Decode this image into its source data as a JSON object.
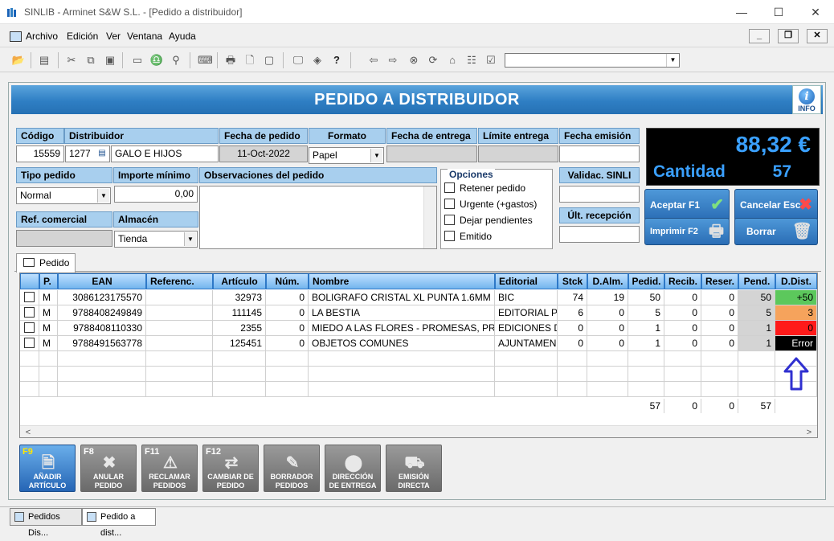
{
  "window": {
    "title": "SINLIB - Arminet S&W S.L. - [Pedido a distribuidor]",
    "minimize": "—",
    "maximize": "☐",
    "close": "✕"
  },
  "menu": {
    "items": [
      "Archivo",
      "Edición",
      "Ver",
      "Ventana",
      "Ayuda"
    ],
    "mdi_min": "_",
    "mdi_restore": "❐",
    "mdi_close": "✕"
  },
  "banner": {
    "title": "PEDIDO A DISTRIBUIDOR",
    "info_label": "INFO"
  },
  "header": {
    "codigo_label": "Código",
    "codigo": "15559",
    "distribuidor_label": "Distribuidor",
    "distribuidor_code": "1277",
    "distribuidor_name": "GALO E HIJOS",
    "fecha_pedido_label": "Fecha de pedido",
    "fecha_pedido": "11-Oct-2022",
    "formato_label": "Formato",
    "formato": "Papel",
    "fecha_entrega_label": "Fecha de entrega",
    "fecha_entrega": "",
    "limite_entrega_label": "Límite entrega",
    "limite_entrega": "",
    "fecha_emision_label": "Fecha emisión",
    "fecha_emision": "",
    "tipo_pedido_label": "Tipo pedido",
    "tipo_pedido": "Normal",
    "importe_minimo_label": "Importe mínimo",
    "importe_minimo": "0,00",
    "observaciones_label": "Observaciones del pedido",
    "observaciones": "",
    "ref_comercial_label": "Ref. comercial",
    "ref_comercial": "",
    "almacen_label": "Almacén",
    "almacen": "Tienda",
    "validac_label": "Validac. SINLI",
    "validac": "",
    "ult_recepcion_label": "Últ. recepción",
    "ult_recepcion": ""
  },
  "opciones": {
    "title": "Opciones",
    "items": [
      "Retener pedido",
      "Urgente (+gastos)",
      "Dejar pendientes",
      "Emitido"
    ]
  },
  "total": {
    "amount": "88,32 €",
    "label": "Cantidad",
    "qty": "57"
  },
  "actions": {
    "aceptar": "Aceptar F1",
    "cancelar": "Cancelar Esc",
    "imprimir": "Imprimir F2",
    "borrar": "Borrar"
  },
  "tab": {
    "label": "Pedido"
  },
  "grid": {
    "headers": [
      "P.",
      "EAN",
      "Referenc.",
      "Artículo",
      "Núm.",
      "Nombre",
      "Editorial",
      "Stck",
      "D.Alm.",
      "Pedid.",
      "Recib.",
      "Reser.",
      "Pend.",
      "D.Dist."
    ],
    "rows": [
      {
        "p": "M",
        "ean": "3086123175570",
        "ref": "",
        "articulo": "32973",
        "num": "0",
        "nombre": "BOLIGRAFO CRISTAL XL PUNTA 1.6MM",
        "editorial": "BIC",
        "stck": "74",
        "dalm": "19",
        "pedid": "50",
        "recib": "0",
        "reser": "0",
        "pend": "50",
        "ddist": "+50",
        "ddist_bg": "#5cc85c",
        "ddist_fg": "#000000"
      },
      {
        "p": "M",
        "ean": "9788408249849",
        "ref": "",
        "articulo": "111145",
        "num": "0",
        "nombre": "LA BESTIA",
        "editorial": "EDITORIAL P",
        "stck": "6",
        "dalm": "0",
        "pedid": "5",
        "recib": "0",
        "reser": "0",
        "pend": "5",
        "ddist": "3",
        "ddist_bg": "#f6a35c",
        "ddist_fg": "#000000"
      },
      {
        "p": "M",
        "ean": "9788408110330",
        "ref": "",
        "articulo": "2355",
        "num": "0",
        "nombre": "MIEDO A LAS FLORES - PROMESAS, PR",
        "editorial": "EDICIONES D",
        "stck": "0",
        "dalm": "0",
        "pedid": "1",
        "recib": "0",
        "reser": "0",
        "pend": "1",
        "ddist": "0",
        "ddist_bg": "#ff1a1a",
        "ddist_fg": "#000000"
      },
      {
        "p": "M",
        "ean": "9788491563778",
        "ref": "",
        "articulo": "125451",
        "num": "0",
        "nombre": "OBJETOS COMUNES",
        "editorial": "AJUNTAMEN",
        "stck": "0",
        "dalm": "0",
        "pedid": "1",
        "recib": "0",
        "reser": "0",
        "pend": "1",
        "ddist": "Error",
        "ddist_bg": "#000000",
        "ddist_fg": "#ffffff"
      }
    ],
    "totals": {
      "pedid": "57",
      "recib": "0",
      "reser": "0",
      "pend": "57"
    }
  },
  "fkeys": [
    {
      "key": "F9",
      "label1": "AÑADIR",
      "label2": "ARTÍCULO",
      "active": true,
      "icon": "add-document-icon"
    },
    {
      "key": "F8",
      "label1": "ANULAR",
      "label2": "PEDIDO",
      "active": false,
      "icon": "cancel-cart-icon"
    },
    {
      "key": "F11",
      "label1": "RECLAMAR",
      "label2": "PEDIDOS",
      "active": false,
      "icon": "claim-cart-icon"
    },
    {
      "key": "F12",
      "label1": "CAMBIAR DE",
      "label2": "PEDIDO",
      "active": false,
      "icon": "swap-cart-icon"
    },
    {
      "key": "",
      "label1": "BORRADOR",
      "label2": "PEDIDOS",
      "active": false,
      "icon": "draft-icon"
    },
    {
      "key": "",
      "label1": "DIRECCIÓN",
      "label2": "DE ENTREGA",
      "active": false,
      "icon": "location-pin-icon"
    },
    {
      "key": "",
      "label1": "EMISIÓN",
      "label2": "DIRECTA",
      "active": false,
      "icon": "truck-icon"
    }
  ],
  "taskbar": {
    "items": [
      "Pedidos Dis...",
      "Pedido a dist..."
    ]
  },
  "colors": {
    "accent": "#2f7fc4",
    "header_bg": "#a8cfee",
    "total_text": "#3aa0ff",
    "annotation_arrow": "#3030d0"
  }
}
